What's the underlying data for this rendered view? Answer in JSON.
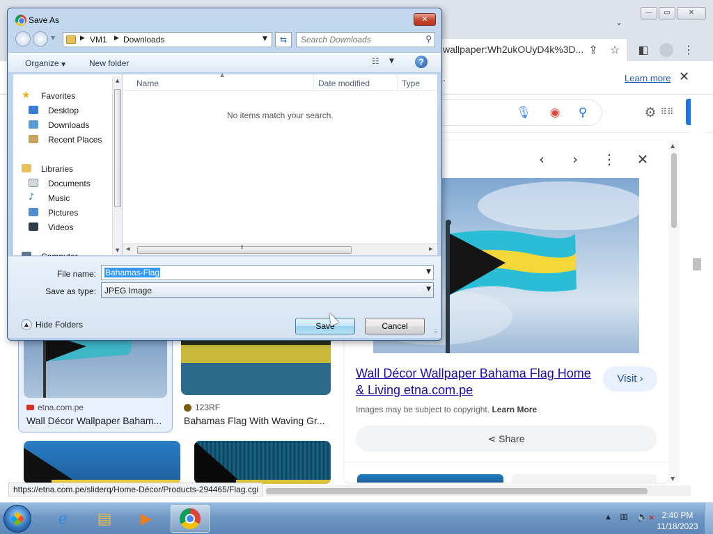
{
  "browser": {
    "omnibox_text": "wallpaper:Wh2ukOUyD4k%3D...",
    "infobar_text": ".",
    "learn_more": "Learn more",
    "result_cards": [
      {
        "source": "etna.com.pe",
        "title": "Wall Décor Wallpaper Baham..."
      },
      {
        "source": "123RF",
        "title": "Bahamas Flag With Waving Gr..."
      }
    ],
    "preview": {
      "title": "Wall Décor Wallpaper Bahama Flag Home & Living etna.com.pe",
      "visit_label": "Visit",
      "copyright_text": "Images may be subject to copyright.",
      "copyright_link": "Learn More",
      "share_label": "Share"
    },
    "status_url": "https://etna.com.pe/sliderq/Home-Décor/Products-294465/Flag.cgi"
  },
  "dialog": {
    "title": "Save As",
    "address": {
      "segment1": "VM1",
      "segment2": "Downloads"
    },
    "search_placeholder": "Search Downloads",
    "toolbar": {
      "organize": "Organize",
      "new_folder": "New folder"
    },
    "nav": {
      "favorites": "Favorites",
      "desktop": "Desktop",
      "downloads": "Downloads",
      "recent": "Recent Places",
      "libraries": "Libraries",
      "documents": "Documents",
      "music": "Music",
      "pictures": "Pictures",
      "videos": "Videos",
      "computer": "Computer"
    },
    "columns": {
      "name": "Name",
      "date_modified": "Date modified",
      "type": "Type"
    },
    "empty_message": "No items match your search.",
    "file_name_label": "File name:",
    "file_name_value": "Bahamas-Flag",
    "save_type_label": "Save as type:",
    "save_type_value": "JPEG Image",
    "hide_folders": "Hide Folders",
    "save_button": "Save",
    "cancel_button": "Cancel"
  },
  "taskbar": {
    "time": "2:40 PM",
    "date": "11/18/2023"
  }
}
